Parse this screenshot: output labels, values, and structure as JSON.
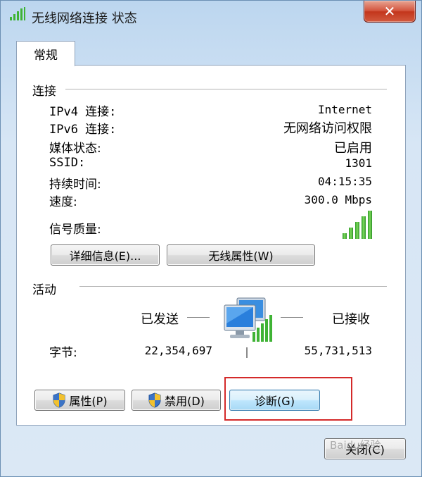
{
  "window": {
    "title": "无线网络连接 状态"
  },
  "tabs": [
    {
      "label": "常规"
    }
  ],
  "connection": {
    "section_label": "连接",
    "rows": [
      {
        "label": "IPv4 连接:",
        "value": "Internet"
      },
      {
        "label": "IPv6 连接:",
        "value": "无网络访问权限"
      },
      {
        "label": "媒体状态:",
        "value": "已启用"
      },
      {
        "label": "SSID:",
        "value": "1301"
      },
      {
        "label": "持续时间:",
        "value": "04:15:35"
      },
      {
        "label": "速度:",
        "value": "300.0 Mbps"
      }
    ],
    "signal_label": "信号质量:",
    "signal_level": 5,
    "signal_max": 5,
    "details_button": "详细信息(E)...",
    "wireless_props_button": "无线属性(W)"
  },
  "activity": {
    "section_label": "活动",
    "sent_label": "已发送",
    "received_label": "已接收",
    "bytes_label": "字节:",
    "bytes_sent": "22,354,697",
    "bytes_received": "55,731,513"
  },
  "buttons": {
    "properties": "属性(P)",
    "disable": "禁用(D)",
    "diagnose": "诊断(G)",
    "close": "关闭(C)"
  },
  "watermark": "Baidu经验",
  "colors": {
    "highlight_box": "#d42a2a",
    "signal_green": "#3fb335",
    "close_button": "#c3361c"
  }
}
